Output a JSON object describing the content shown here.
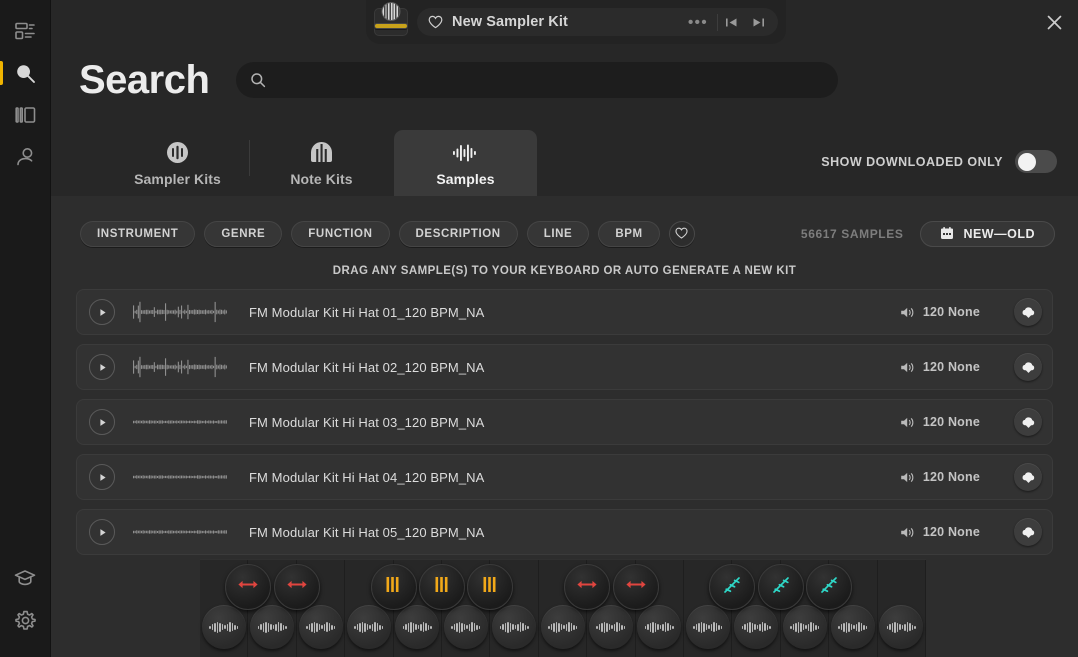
{
  "window": {
    "close_label": "×"
  },
  "topbar": {
    "kit_name": "New Sampler Kit",
    "more_label": "•••",
    "heart_icon": "heart-icon",
    "prev_icon": "skip-previous-icon",
    "next_icon": "skip-next-icon",
    "thumb_icon": "kit-thumbnail-icon"
  },
  "sidebar": {
    "items": [
      {
        "name": "dashboard",
        "icon": "dashboard-icon",
        "active": false
      },
      {
        "name": "search",
        "icon": "search-icon",
        "active": true
      },
      {
        "name": "library",
        "icon": "library-panels-icon",
        "active": false
      },
      {
        "name": "account",
        "icon": "user-account-icon",
        "active": false
      }
    ],
    "bottom_items": [
      {
        "name": "learn",
        "icon": "graduation-cap-icon",
        "active": false
      },
      {
        "name": "settings",
        "icon": "gear-icon",
        "active": false
      }
    ]
  },
  "page": {
    "title": "Search"
  },
  "search": {
    "value": "",
    "placeholder": "",
    "icon": "search-icon"
  },
  "tabs": [
    {
      "label": "Sampler Kits",
      "icon": "sampler-kits-icon",
      "active": false
    },
    {
      "label": "Note Kits",
      "icon": "note-kits-icon",
      "active": false
    },
    {
      "label": "Samples",
      "icon": "samples-waveform-icon",
      "active": true
    }
  ],
  "downloaded_toggle": {
    "label": "SHOW DOWNLOADED ONLY",
    "enabled": false
  },
  "filters": {
    "pills": [
      "INSTRUMENT",
      "GENRE",
      "FUNCTION",
      "DESCRIPTION",
      "LINE",
      "BPM"
    ],
    "favorite_icon": "heart-icon"
  },
  "results_meta": {
    "count_label": "56617 SAMPLES",
    "sort_label": "NEW—OLD",
    "sort_icon": "calendar-icon"
  },
  "drag_hint": "DRAG ANY SAMPLE(S) TO YOUR KEYBOARD OR AUTO GENERATE A NEW KIT",
  "samples": [
    {
      "name": "FM Modular Kit Hi Hat 01_120 BPM_NA",
      "bpm": "120 None",
      "play_icon": "play-icon",
      "speaker_icon": "speaker-icon",
      "download_icon": "download-cloud-icon",
      "wave": "dense"
    },
    {
      "name": "FM Modular Kit Hi Hat 02_120 BPM_NA",
      "bpm": "120 None",
      "play_icon": "play-icon",
      "speaker_icon": "speaker-icon",
      "download_icon": "download-cloud-icon",
      "wave": "dense"
    },
    {
      "name": "FM Modular Kit Hi Hat 03_120 BPM_NA",
      "bpm": "120 None",
      "play_icon": "play-icon",
      "speaker_icon": "speaker-icon",
      "download_icon": "download-cloud-icon",
      "wave": "flat"
    },
    {
      "name": "FM Modular Kit Hi Hat 04_120 BPM_NA",
      "bpm": "120 None",
      "play_icon": "play-icon",
      "speaker_icon": "speaker-icon",
      "download_icon": "download-cloud-icon",
      "wave": "flat"
    },
    {
      "name": "FM Modular Kit Hi Hat 05_120 BPM_NA",
      "bpm": "120 None",
      "play_icon": "play-icon",
      "speaker_icon": "speaker-icon",
      "download_icon": "download-cloud-icon",
      "wave": "flat"
    }
  ],
  "keyboard": {
    "white_key_count": 15,
    "black_keys": [
      {
        "index": 0,
        "icon": "arrow-lr-icon",
        "color": "#e0453f"
      },
      {
        "index": 1,
        "icon": "arrow-lr-icon",
        "color": "#e0453f"
      },
      {
        "index": 2,
        "icon": "bars-icon",
        "color": "#f2a919"
      },
      {
        "index": 3,
        "icon": "bars-icon",
        "color": "#f2a919"
      },
      {
        "index": 4,
        "icon": "bars-icon",
        "color": "#f2a919"
      },
      {
        "index": 5,
        "icon": "arrow-lr-icon",
        "color": "#e0453f"
      },
      {
        "index": 6,
        "icon": "arrow-lr-icon",
        "color": "#e0453f"
      },
      {
        "index": 7,
        "icon": "zigzag-icon",
        "color": "#2fd8c8"
      },
      {
        "index": 8,
        "icon": "zigzag-icon",
        "color": "#2fd8c8"
      },
      {
        "index": 9,
        "icon": "zigzag-icon",
        "color": "#2fd8c8"
      }
    ],
    "knob_icon": "mini-waveform-icon"
  },
  "colors": {
    "accent_yellow": "#f0b400",
    "accent_orange": "#f2a919",
    "accent_red": "#e0453f",
    "accent_cyan": "#2fd8c8",
    "panel_bg": "#272727",
    "content_bg": "#2d2d2d"
  }
}
